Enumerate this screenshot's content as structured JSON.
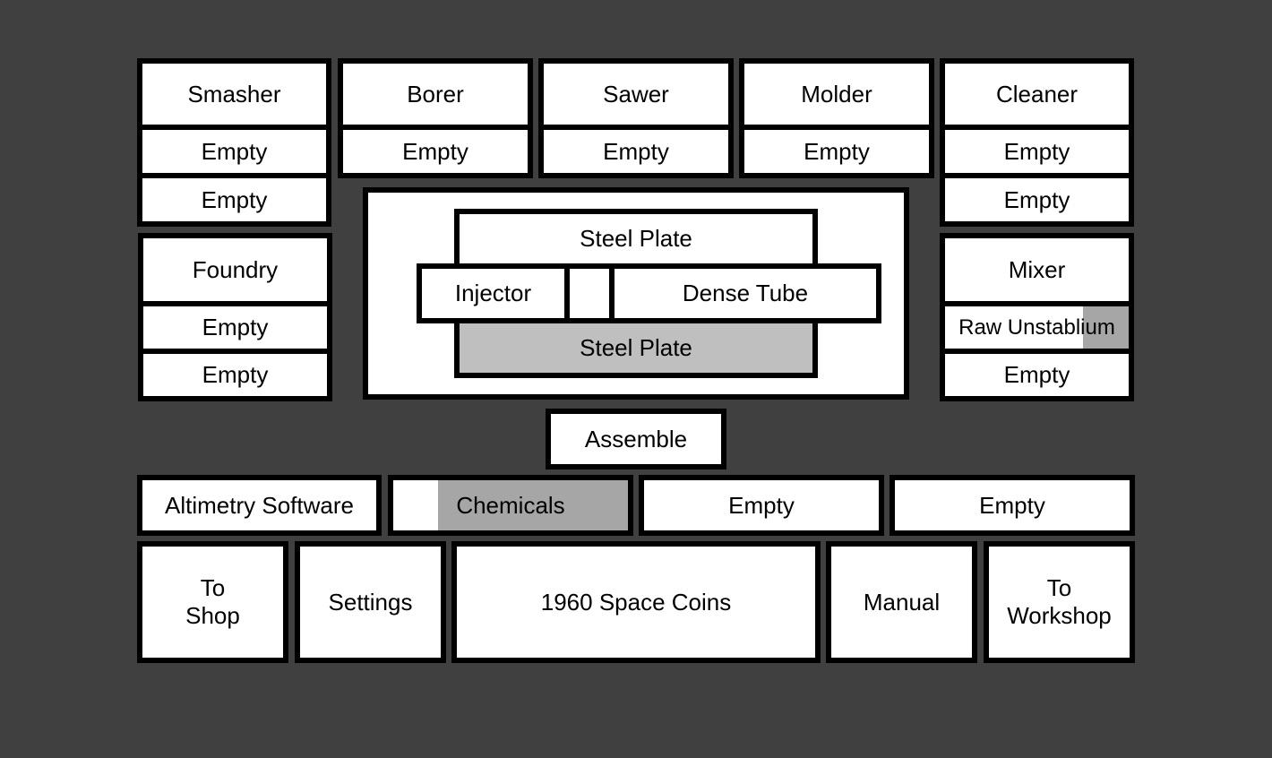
{
  "machines": {
    "smasher": {
      "name": "Smasher",
      "slots": [
        "Empty",
        "Empty"
      ]
    },
    "borer": {
      "name": "Borer",
      "slots": [
        "Empty"
      ]
    },
    "sawer": {
      "name": "Sawer",
      "slots": [
        "Empty"
      ]
    },
    "molder": {
      "name": "Molder",
      "slots": [
        "Empty"
      ]
    },
    "cleaner": {
      "name": "Cleaner",
      "slots": [
        "Empty",
        "Empty"
      ]
    },
    "foundry": {
      "name": "Foundry",
      "slots": [
        "Empty",
        "Empty"
      ]
    },
    "mixer": {
      "name": "Mixer",
      "slots": [
        "Raw Unstablium",
        "Empty"
      ],
      "progress": [
        0.25,
        0
      ]
    }
  },
  "assembly": {
    "top": "Steel Plate",
    "left": "Injector",
    "center": "",
    "right": "Dense Tube",
    "bottom": "Steel Plate"
  },
  "assemble_label": "Assemble",
  "inventory": [
    {
      "label": "Altimetry Software",
      "progress": 0
    },
    {
      "label": "Chemicals",
      "progress": 0.81
    },
    {
      "label": "Empty",
      "progress": 0
    },
    {
      "label": "Empty",
      "progress": 0
    }
  ],
  "footer": {
    "to_shop": [
      "To",
      "Shop"
    ],
    "settings": "Settings",
    "coins": "1960 Space Coins",
    "manual": "Manual",
    "to_workshop": [
      "To",
      "Workshop"
    ]
  }
}
